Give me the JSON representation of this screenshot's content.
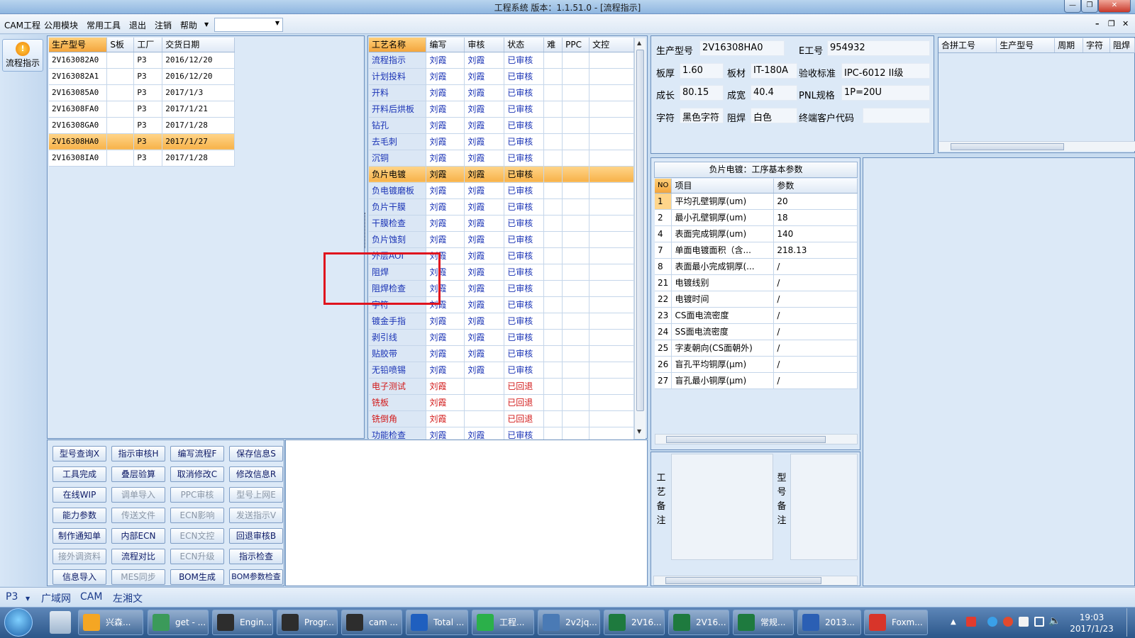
{
  "window": {
    "title": "工程系统   版本：1.1.51.0 - [流程指示]"
  },
  "menu": [
    "CAM工程",
    "公用模块",
    "常用工具",
    "退出",
    "注销",
    "帮助"
  ],
  "flow_button": {
    "label": "流程指示"
  },
  "orders": {
    "headers": [
      "生产型号",
      "S板",
      "工厂",
      "交货日期"
    ],
    "rows": [
      [
        "2V163082A0",
        "",
        "P3",
        "2016/12/20"
      ],
      [
        "2V163082A1",
        "",
        "P3",
        "2016/12/20"
      ],
      [
        "2V163085A0",
        "",
        "P3",
        "2017/1/3"
      ],
      [
        "2V16308FA0",
        "",
        "P3",
        "2017/1/21"
      ],
      [
        "2V16308GA0",
        "",
        "P3",
        "2017/1/28"
      ],
      [
        "2V16308HA0",
        "",
        "P3",
        "2017/1/27"
      ],
      [
        "2V16308IA0",
        "",
        "P3",
        "2017/1/28"
      ]
    ],
    "selected": 5
  },
  "process": {
    "headers": [
      "工艺名称",
      "编写",
      "审核",
      "状态",
      "难",
      "PPC",
      "文控"
    ],
    "rows": [
      [
        "流程指示",
        "刘霞",
        "刘霞",
        "已审核"
      ],
      [
        "计划投料",
        "刘霞",
        "刘霞",
        "已审核"
      ],
      [
        "开料",
        "刘霞",
        "刘霞",
        "已审核"
      ],
      [
        "开料后烘板",
        "刘霞",
        "刘霞",
        "已审核"
      ],
      [
        "钻孔",
        "刘霞",
        "刘霞",
        "已审核"
      ],
      [
        "去毛刺",
        "刘霞",
        "刘霞",
        "已审核"
      ],
      [
        "沉铜",
        "刘霞",
        "刘霞",
        "已审核"
      ],
      [
        "负片电镀",
        "刘霞",
        "刘霞",
        "已审核"
      ],
      [
        "负电镀磨板",
        "刘霞",
        "刘霞",
        "已审核"
      ],
      [
        "负片干膜",
        "刘霞",
        "刘霞",
        "已审核"
      ],
      [
        "干膜检查",
        "刘霞",
        "刘霞",
        "已审核"
      ],
      [
        "负片蚀刻",
        "刘霞",
        "刘霞",
        "已审核"
      ],
      [
        "外层AOI",
        "刘霞",
        "刘霞",
        "已审核"
      ],
      [
        "阻焊",
        "刘霞",
        "刘霞",
        "已审核"
      ],
      [
        "阻焊检查",
        "刘霞",
        "刘霞",
        "已审核"
      ],
      [
        "字符",
        "刘霞",
        "刘霞",
        "已审核"
      ],
      [
        "镀金手指",
        "刘霞",
        "刘霞",
        "已审核"
      ],
      [
        "剥引线",
        "刘霞",
        "刘霞",
        "已审核"
      ],
      [
        "贴胶带",
        "刘霞",
        "刘霞",
        "已审核"
      ],
      [
        "无铅喷锡",
        "刘霞",
        "刘霞",
        "已审核"
      ],
      [
        "电子测试",
        "刘霞",
        "",
        "已回退"
      ],
      [
        "铣板",
        "刘霞",
        "",
        "已回退"
      ],
      [
        "铣倒角",
        "刘霞",
        "",
        "已回退"
      ],
      [
        "功能检查",
        "刘霞",
        "刘霞",
        "已审核"
      ]
    ],
    "selected": 7
  },
  "buttons": [
    [
      "型号查询X",
      "指示审核H",
      "编写流程F",
      "保存信息S"
    ],
    [
      "工具完成",
      "叠层验算",
      "取消修改C",
      "修改信息R"
    ],
    [
      "在线WIP",
      "调单导入",
      "PPC审核",
      "型号上网E"
    ],
    [
      "能力参数",
      "传送文件",
      "ECN影响",
      "发送指示V"
    ],
    [
      "制作通知单",
      "内部ECN",
      "ECN文控",
      "回退审核B"
    ],
    [
      "接外调资料",
      "流程对比",
      "ECN升级",
      "指示检查"
    ],
    [
      "信息导入",
      "MES同步",
      "BOM生成",
      "BOM参数检查"
    ]
  ],
  "info": {
    "labels": {
      "model": "生产型号",
      "e_no": "E工号",
      "thickness": "板厚",
      "material": "板材",
      "standard": "验收标准",
      "length": "成长",
      "width": "成宽",
      "pnl": "PNL规格",
      "char": "字符",
      "mask": "阻焊",
      "customer": "终端客户代码"
    },
    "model": "2V16308HA0",
    "e_no": "954932",
    "thickness": "1.60",
    "material": "IT-180A",
    "standard": "IPC-6012 II级",
    "length": "80.15",
    "width": "40.4",
    "pnl": "1P=20U",
    "char": "黑色字符",
    "mask": "白色",
    "customer": ""
  },
  "merge": {
    "headers": [
      "合拼工号",
      "生产型号",
      "周期",
      "字符",
      "阻焊"
    ]
  },
  "params": {
    "title": "负片电镀：工序基本参数",
    "headers": [
      "NO",
      "项目",
      "参数"
    ],
    "rows": [
      [
        "1",
        "平均孔壁铜厚(um)",
        "20"
      ],
      [
        "2",
        "最小孔壁铜厚(um)",
        "18"
      ],
      [
        "4",
        "表面完成铜厚(um)",
        "140"
      ],
      [
        "7",
        "单面电镀面积（含...",
        "218.13"
      ],
      [
        "8",
        "表面最小完成铜厚(...",
        "/"
      ],
      [
        "21",
        "电镀线别",
        "/"
      ],
      [
        "22",
        "电镀时间",
        "/"
      ],
      [
        "23",
        "CS面电流密度",
        "/"
      ],
      [
        "24",
        "SS面电流密度",
        "/"
      ],
      [
        "25",
        "字麦朝向(CS面朝外)",
        "/"
      ],
      [
        "26",
        "盲孔平均铜厚(μm)",
        "/"
      ],
      [
        "27",
        "盲孔最小铜厚(μm)",
        "/"
      ]
    ]
  },
  "notes": {
    "process_label": "工艺备注",
    "model_label": "型号备注"
  },
  "status": {
    "combo": "P3",
    "tabs": [
      "广域网",
      "CAM",
      "左湘文"
    ]
  },
  "taskbar": {
    "items": [
      "兴森...",
      "get - ...",
      "Engin...",
      "Progr...",
      "cam ...",
      "Total ...",
      "工程...",
      "2v2jq...",
      "2V16...",
      "2V16...",
      "常规...",
      "2013...",
      "Foxm..."
    ],
    "time": "19:03",
    "date": "2017/1/23"
  },
  "colors": {
    "selection": "#f7b24a",
    "audited": "#1a33b5",
    "returned": "#d21a1a",
    "highlight": "#e0141e"
  }
}
